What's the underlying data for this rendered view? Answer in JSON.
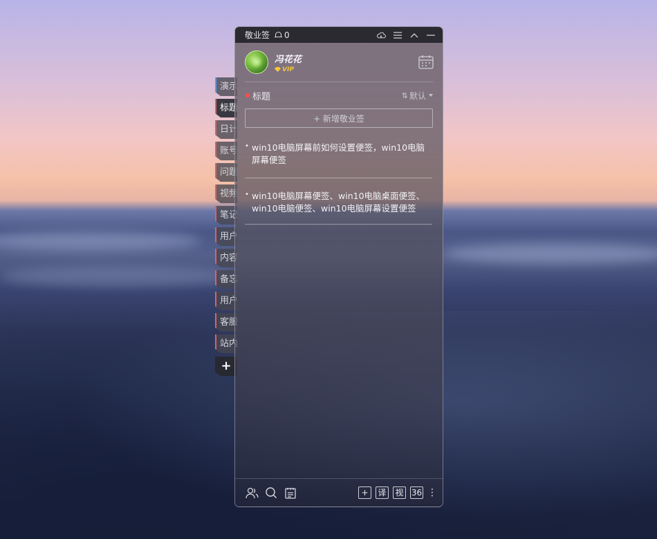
{
  "titlebar": {
    "app_name": "敬业签",
    "notification_count": "0",
    "icons": [
      "cloud-sync-icon",
      "menu-icon",
      "collapse-up-icon",
      "minimize-icon"
    ]
  },
  "user": {
    "name": "冯花花",
    "badge": "VIP",
    "calendar_icon": "calendar-icon"
  },
  "side_tabs": {
    "items": [
      {
        "label": "演示"
      },
      {
        "label": "标题"
      },
      {
        "label": "日计"
      },
      {
        "label": "账号"
      },
      {
        "label": "问题"
      },
      {
        "label": "视频"
      },
      {
        "label": "笔记"
      },
      {
        "label": "用户"
      },
      {
        "label": "内容"
      },
      {
        "label": "备忘"
      },
      {
        "label": "用户"
      },
      {
        "label": "客服"
      },
      {
        "label": "站内"
      }
    ],
    "add_label": "+"
  },
  "section": {
    "title": "标题",
    "sort_label": "默认"
  },
  "add_note": {
    "label": "+ 新增敬业签"
  },
  "notes": [
    {
      "text": "win10电脑屏幕前如何设置便签，win10电脑屏幕便签"
    },
    {
      "text": "win10电脑屏幕便签、win10电脑桌面便签、win10电脑便签、win10电脑屏幕设置便签"
    }
  ],
  "bottom_bar": {
    "left_icons": [
      "contacts-icon",
      "search-icon",
      "notes-list-icon"
    ],
    "buttons": [
      "+",
      "译",
      "视",
      "36"
    ],
    "more": "⋮"
  },
  "colors": {
    "tab_accent": "#d5646c",
    "first_tab_accent": "#4aa0ff",
    "dot": "#ff4d4d",
    "vip": "#f3c63a"
  }
}
